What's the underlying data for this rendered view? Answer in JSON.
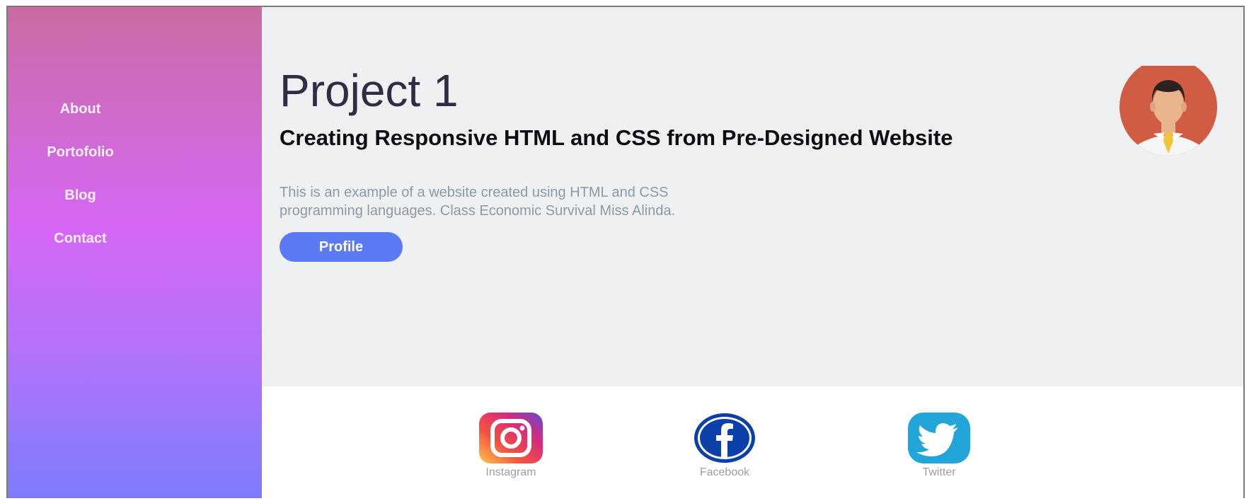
{
  "sidebar": {
    "nav": [
      {
        "label": "About"
      },
      {
        "label": "Portofolio"
      },
      {
        "label": "Blog"
      },
      {
        "label": "Contact"
      }
    ]
  },
  "hero": {
    "title": "Project 1",
    "subtitle": "Creating Responsive HTML and CSS from Pre-Designed Website",
    "description_line1": "This is an example of a website created using HTML and CSS",
    "description_line2": "programming languages. Class Economic Survival Miss Alinda.",
    "profile_button": "Profile",
    "avatar_icon": "person-avatar-icon"
  },
  "social": [
    {
      "label": "Instagram",
      "icon": "instagram-icon"
    },
    {
      "label": "Facebook",
      "icon": "facebook-icon"
    },
    {
      "label": "Twitter",
      "icon": "twitter-icon"
    }
  ],
  "colors": {
    "sidebar_top": "#c96ba3",
    "sidebar_mid": "#d566f5",
    "sidebar_bottom": "#7c7cfb",
    "button": "#5b7af4",
    "main_bg": "#eff0f2",
    "avatar_bg": "#cf5c43"
  }
}
